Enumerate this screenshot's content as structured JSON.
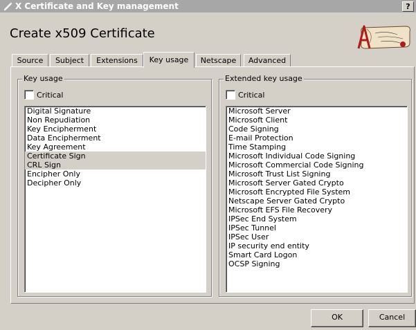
{
  "window": {
    "title": "X Certificate and Key management",
    "help_label": "?"
  },
  "page_title": "Create x509 Certificate",
  "tabs": [
    {
      "label": "Source",
      "active": false
    },
    {
      "label": "Subject",
      "active": false
    },
    {
      "label": "Extensions",
      "active": false
    },
    {
      "label": "Key usage",
      "active": true
    },
    {
      "label": "Netscape",
      "active": false
    },
    {
      "label": "Advanced",
      "active": false
    }
  ],
  "key_usage": {
    "title": "Key usage",
    "critical_label": "Critical",
    "critical_checked": false,
    "items": [
      {
        "label": "Digital Signature",
        "selected": false
      },
      {
        "label": "Non Repudiation",
        "selected": false
      },
      {
        "label": "Key Encipherment",
        "selected": false
      },
      {
        "label": "Data Encipherment",
        "selected": false
      },
      {
        "label": "Key Agreement",
        "selected": false
      },
      {
        "label": "Certificate Sign",
        "selected": true
      },
      {
        "label": "CRL Sign",
        "selected": true
      },
      {
        "label": "Encipher Only",
        "selected": false
      },
      {
        "label": "Decipher Only",
        "selected": false
      }
    ]
  },
  "extended_key_usage": {
    "title": "Extended key usage",
    "critical_label": "Critical",
    "critical_checked": false,
    "items": [
      "Microsoft Server",
      "Microsoft Client",
      "Code Signing",
      "E-mail Protection",
      "Time Stamping",
      "Microsoft Individual Code Signing",
      "Microsoft Commercial Code Signing",
      "Microsoft Trust List Signing",
      "Microsoft Server Gated Crypto",
      "Microsoft Encrypted File System",
      "Netscape Server Gated Crypto",
      "Microsoft EFS File Recovery",
      "IPSec End System",
      "IPSec Tunnel",
      "IPSec User",
      "IP security end entity",
      "Smart Card Logon",
      "OCSP Signing"
    ]
  },
  "buttons": {
    "ok": "OK",
    "cancel": "Cancel"
  },
  "logo_icon": "xca-logo-scroll-icon",
  "colors": {
    "titlebar": "#a7a7a7",
    "dialog_bg": "#d4d0c8",
    "selection": "#d4d0c8",
    "logo_red": "#b01a1a"
  }
}
